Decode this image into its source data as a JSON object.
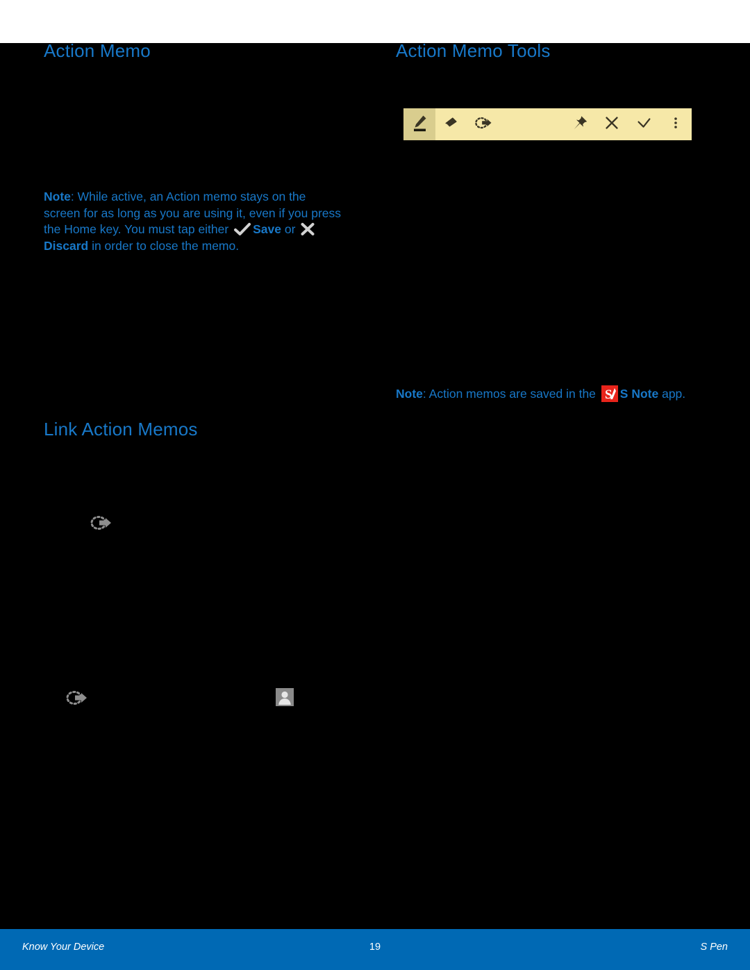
{
  "document": {
    "headings": {
      "action_memo": "Action Memo",
      "action_memo_tools": "Action Memo Tools",
      "link_action_memos": "Link Action Memos"
    },
    "notes": {
      "left": {
        "label": "Note",
        "colon": ":",
        "text_part1": " While active, an Action memo stays on the screen for as long as you are using it, even if you press the Home key. You must tap either ",
        "save_label": "Save",
        "text_part2": " or ",
        "discard_label": "Discard",
        "text_part3": " in order to close the memo."
      },
      "right": {
        "label": "Note",
        "colon": ":",
        "text_part1": " Action memos are saved in the ",
        "app_label": "S Note",
        "text_part2": " app."
      }
    },
    "memo_toolbar": {
      "background_color": "#f6e8a8",
      "selected_color": "#d9cd8e",
      "buttons": [
        {
          "name": "pen-icon",
          "label": "Pen",
          "selected": true
        },
        {
          "name": "eraser-icon",
          "label": "Eraser",
          "selected": false
        },
        {
          "name": "link-action-icon",
          "label": "Link action",
          "selected": false
        },
        {
          "name": "pin-icon",
          "label": "Pin",
          "selected": false
        },
        {
          "name": "close-icon",
          "label": "Discard",
          "selected": false
        },
        {
          "name": "check-icon",
          "label": "Save",
          "selected": false
        },
        {
          "name": "more-options-icon",
          "label": "More options",
          "selected": false
        }
      ]
    },
    "figure_icons": [
      {
        "name": "link-action-icon",
        "label": "Link action"
      },
      {
        "name": "link-action-icon",
        "label": "Link action"
      },
      {
        "name": "contact-icon",
        "label": "Contact"
      }
    ],
    "footer": {
      "left": "Know Your Device",
      "page_number": "19",
      "right": "S Pen",
      "background_color": "#0069b4"
    },
    "colors": {
      "accent_blue": "#1878c8",
      "page_background": "#000000",
      "snote_red": "#e8241b"
    }
  }
}
